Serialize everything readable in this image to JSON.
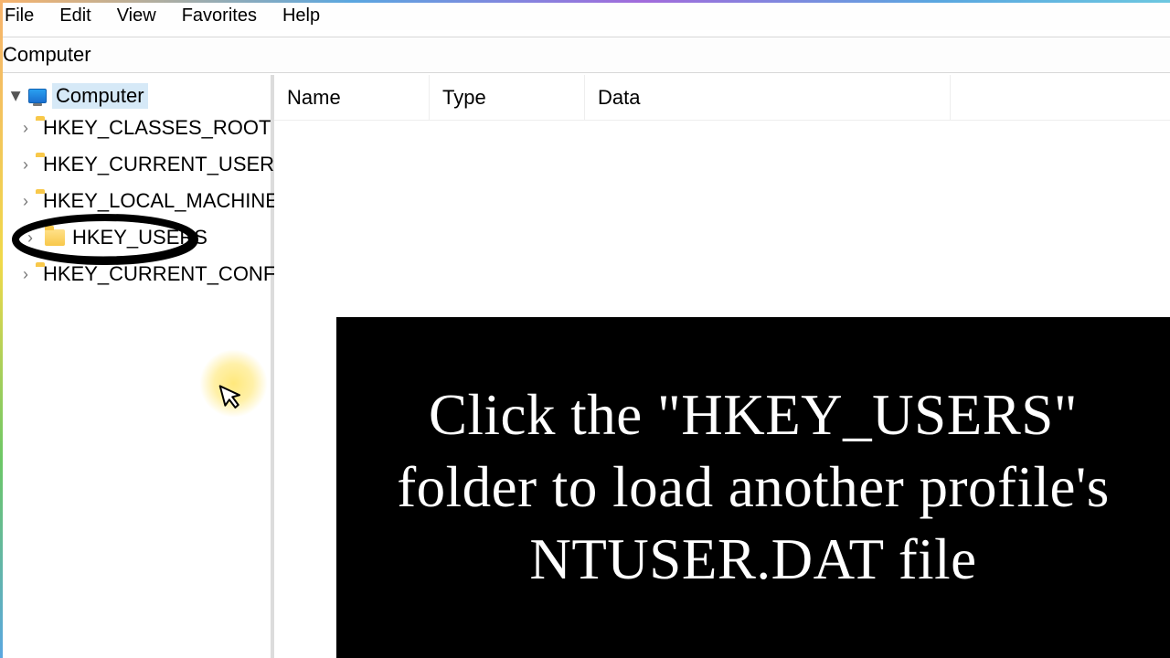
{
  "menubar": {
    "file": "File",
    "edit": "Edit",
    "view": "View",
    "favorites": "Favorites",
    "help": "Help"
  },
  "addressbar": {
    "path": "Computer"
  },
  "tree": {
    "root_label": "Computer",
    "items": [
      {
        "label": "HKEY_CLASSES_ROOT"
      },
      {
        "label": "HKEY_CURRENT_USER"
      },
      {
        "label": "HKEY_LOCAL_MACHINE"
      },
      {
        "label": "HKEY_USERS"
      },
      {
        "label": "HKEY_CURRENT_CONFIG"
      }
    ]
  },
  "list_header": {
    "name": "Name",
    "type": "Type",
    "data": "Data"
  },
  "annotation": {
    "caption": "Click the \"HKEY_USERS\" folder to load another profile's NTUSER.DAT file",
    "circled_item": "HKEY_USERS"
  }
}
